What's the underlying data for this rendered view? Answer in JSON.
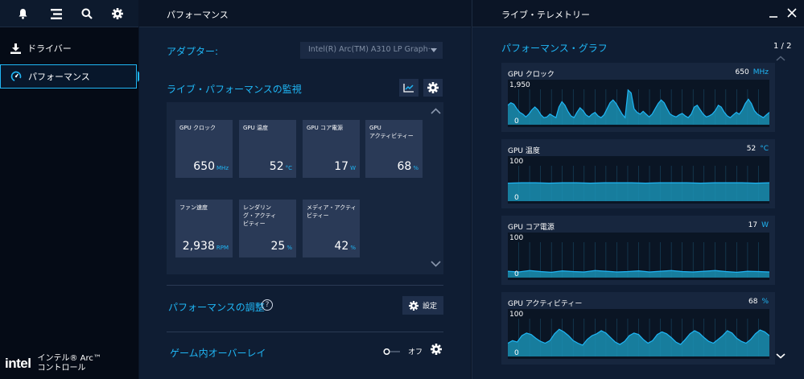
{
  "colors": {
    "accent": "#1fb6f5",
    "panel": "#0f1d33",
    "tile": "#2a3a57",
    "graph_fill": "#1a8fb3"
  },
  "sidebar": {
    "top_icons": [
      "bell-icon",
      "menu-icon",
      "search-icon",
      "gear-icon"
    ],
    "items": [
      {
        "label": "ドライバー",
        "icon": "download-icon"
      },
      {
        "label": "パフォーマンス",
        "icon": "gauge-icon"
      }
    ],
    "brand": {
      "logo": "intel",
      "line1": "インテル® Arc™",
      "line2": "コントロール"
    }
  },
  "main": {
    "header": "パフォーマンス",
    "adapter": {
      "label": "アダプター:",
      "value": "Intel(R) Arc(TM) A310 LP Graph···"
    },
    "live_title": "ライブ・パフォーマンスの監視",
    "metrics": [
      {
        "label": "GPU クロック",
        "value": "650",
        "unit": "MHz"
      },
      {
        "label": "GPU 温度",
        "value": "52",
        "unit": "°C"
      },
      {
        "label": "GPU コア電源",
        "value": "17",
        "unit": "W"
      },
      {
        "label": "GPU\nアクティビティー",
        "value": "68",
        "unit": "%"
      },
      {
        "label": "ファン速度",
        "value": "2,938",
        "unit": "RPM"
      },
      {
        "label": "レンダリン\nグ・アクティ\nビティー",
        "value": "25",
        "unit": "%"
      },
      {
        "label": "メディア・アクティ\nビティー",
        "value": "42",
        "unit": "%"
      }
    ],
    "tuning": {
      "title": "パフォーマンスの調整",
      "help": "?",
      "settings_label": "設定"
    },
    "overlay": {
      "title": "ゲーム内オーバーレイ",
      "toggle_state": "オフ"
    }
  },
  "telemetry": {
    "header": "ライブ・テレメトリー",
    "graph_title": "パフォーマンス・グラフ",
    "page": "1 / 2",
    "graphs": [
      {
        "name": "GPU クロック",
        "value": "650",
        "unit": "MHz",
        "ymax": "1,950",
        "ymin": "0",
        "series": [
          0.55,
          0.62,
          0.58,
          0.45,
          0.35,
          0.3,
          0.22,
          0.3,
          0.42,
          0.5,
          0.42,
          0.28,
          0.2,
          0.22,
          0.3,
          0.25,
          0.2,
          0.5,
          0.65,
          0.55,
          0.38,
          0.25,
          0.2,
          0.35,
          0.48,
          0.4,
          0.28,
          0.22,
          0.3,
          0.35,
          0.25,
          0.2,
          0.28,
          0.45,
          0.62,
          0.7,
          0.6,
          0.45,
          0.3,
          0.2,
          0.98,
          0.9,
          0.45,
          0.35,
          0.3,
          0.38,
          0.3,
          0.22,
          0.3,
          0.45,
          0.6,
          0.7,
          0.62,
          0.45,
          0.3,
          0.25,
          0.22,
          0.28,
          0.32,
          0.25,
          0.2,
          0.3,
          0.5,
          0.55,
          0.42,
          0.3,
          0.22,
          0.25,
          0.3,
          0.4,
          0.55,
          0.5,
          0.35,
          0.25,
          0.2,
          0.28,
          0.35,
          0.3,
          0.42,
          0.6,
          0.72,
          0.6,
          0.4,
          0.3,
          0.25,
          0.2,
          0.28,
          0.35
        ]
      },
      {
        "name": "GPU 温度",
        "value": "52",
        "unit": "°C",
        "ymax": "100",
        "ymin": "0",
        "series": [
          0.51,
          0.52,
          0.52,
          0.51,
          0.52,
          0.52,
          0.51,
          0.52,
          0.52,
          0.52,
          0.51,
          0.52,
          0.52,
          0.52,
          0.51,
          0.52,
          0.52,
          0.52,
          0.51,
          0.52
        ]
      },
      {
        "name": "GPU コア電源",
        "value": "17",
        "unit": "W",
        "ymax": "100",
        "ymin": "0",
        "series": [
          0.18,
          0.16,
          0.2,
          0.17,
          0.15,
          0.19,
          0.17,
          0.16,
          0.2,
          0.18,
          0.16,
          0.17,
          0.19,
          0.16,
          0.18,
          0.2,
          0.17,
          0.16,
          0.18,
          0.2,
          0.17,
          0.15,
          0.18,
          0.17,
          0.16
        ]
      },
      {
        "name": "GPU アクティビティー",
        "value": "68",
        "unit": "%",
        "ymax": "100",
        "ymin": "0",
        "series": [
          0.35,
          0.42,
          0.38,
          0.55,
          0.62,
          0.58,
          0.48,
          0.4,
          0.35,
          0.42,
          0.6,
          0.72,
          0.65,
          0.55,
          0.42,
          0.35,
          0.3,
          0.45,
          0.55,
          0.6,
          0.68,
          0.62,
          0.5,
          0.38,
          0.32,
          0.4,
          0.55,
          0.62,
          0.58,
          0.45,
          0.35,
          0.42,
          0.58,
          0.65,
          0.6,
          0.5,
          0.38,
          0.32,
          0.45,
          0.6,
          0.68,
          0.62,
          0.5,
          0.4,
          0.35,
          0.45,
          0.55,
          0.68,
          0.62,
          0.48,
          0.4,
          0.35,
          0.45,
          0.6,
          0.7,
          0.65,
          0.55
        ]
      }
    ]
  }
}
